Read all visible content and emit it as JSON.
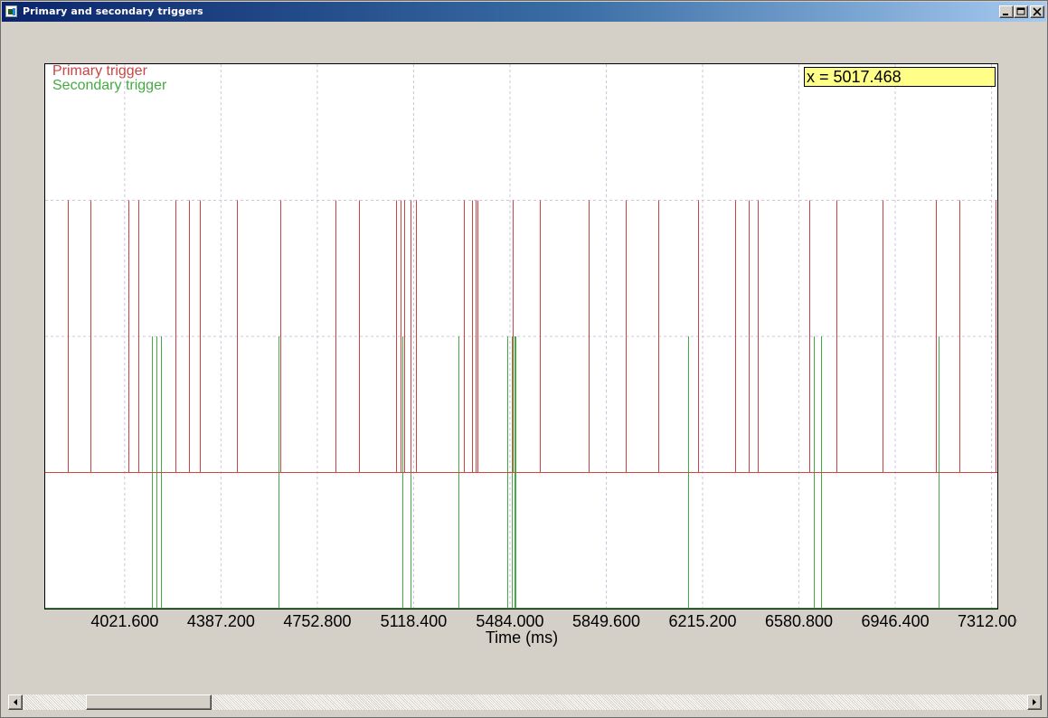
{
  "window": {
    "title": "Primary and secondary triggers"
  },
  "readout": "x = 5017.468",
  "colors": {
    "primary": "#cc4444",
    "secondary": "#44aa44",
    "grid": "#c8c8dc",
    "readout_bg": "#ffff88"
  },
  "chart_data": {
    "type": "line",
    "xlabel": "Time (ms)",
    "ylabel": "",
    "title": "",
    "x_tick_labels": [
      "4021.600",
      "4387.200",
      "4752.800",
      "5118.400",
      "5484.000",
      "5849.600",
      "6215.200",
      "6580.800",
      "6946.400",
      "7312.000"
    ],
    "xlim": [
      3720.0,
      7334.0
    ],
    "ylim": [
      -1.0,
      3.0
    ],
    "grid": true,
    "legend_position": "top-left",
    "series": [
      {
        "name": "Primary trigger",
        "baseline": 0,
        "level": 2,
        "pulse_times": [
          3806,
          3891,
          4037,
          4073,
          4215,
          4267,
          4306,
          4448,
          4613,
          4823,
          4911,
          5050,
          5068,
          5081,
          5105,
          5128,
          5310,
          5339,
          5354,
          5362,
          5493,
          5597,
          5782,
          5924,
          6046,
          6199,
          6337,
          6390,
          6424,
          6620,
          6722,
          6898,
          7101,
          7191,
          7327
        ]
      },
      {
        "name": "Secondary trigger",
        "baseline": 0,
        "level": 1,
        "low": -1,
        "pulse_times": [
          4124,
          4142,
          4160,
          4605,
          5077,
          5108,
          5289,
          5474,
          5490,
          5503,
          5500,
          6159,
          6637,
          6666,
          7112
        ]
      }
    ]
  }
}
